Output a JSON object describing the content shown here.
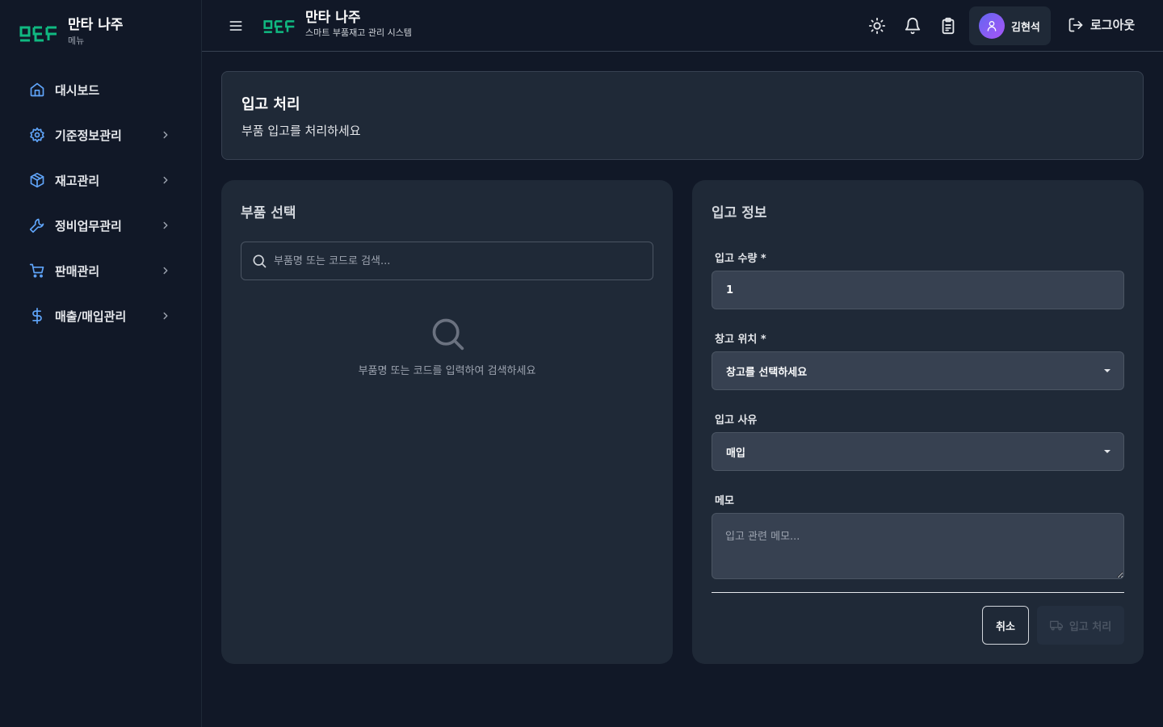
{
  "sidebar": {
    "logo_text": "ㅁㅌㅌ",
    "title": "만타 나주",
    "subtitle": "메뉴",
    "items": [
      {
        "label": "대시보드",
        "icon": "home-icon",
        "has_chevron": false
      },
      {
        "label": "기준정보관리",
        "icon": "gear-icon",
        "has_chevron": true
      },
      {
        "label": "재고관리",
        "icon": "package-icon",
        "has_chevron": true
      },
      {
        "label": "정비업무관리",
        "icon": "wrench-icon",
        "has_chevron": true
      },
      {
        "label": "판매관리",
        "icon": "cart-icon",
        "has_chevron": true
      },
      {
        "label": "매출/매입관리",
        "icon": "dollar-icon",
        "has_chevron": true
      }
    ]
  },
  "topbar": {
    "title": "만타 나주",
    "subtitle": "스마트 부품재고 관리 시스템",
    "user_name": "김현석",
    "logout_label": "로그아웃"
  },
  "page": {
    "title": "입고 처리",
    "subtitle": "부품 입고를 처리하세요"
  },
  "part_select": {
    "title": "부품 선택",
    "search_placeholder": "부품명 또는 코드로 검색...",
    "empty_text": "부품명 또는 코드를 입력하여 검색하세요"
  },
  "receipt_form": {
    "title": "입고 정보",
    "quantity_label": "입고 수량 *",
    "quantity_value": "1",
    "warehouse_label": "창고 위치 *",
    "warehouse_value": "창고를 선택하세요",
    "reason_label": "입고 사유",
    "reason_value": "매입",
    "memo_label": "메모",
    "memo_placeholder": "입고 관련 메모...",
    "cancel_label": "취소",
    "submit_label": "입고 처리"
  },
  "colors": {
    "background": "#111827",
    "panel": "#1f2937",
    "accent": "#60a5fa",
    "logo": "#10b981"
  }
}
